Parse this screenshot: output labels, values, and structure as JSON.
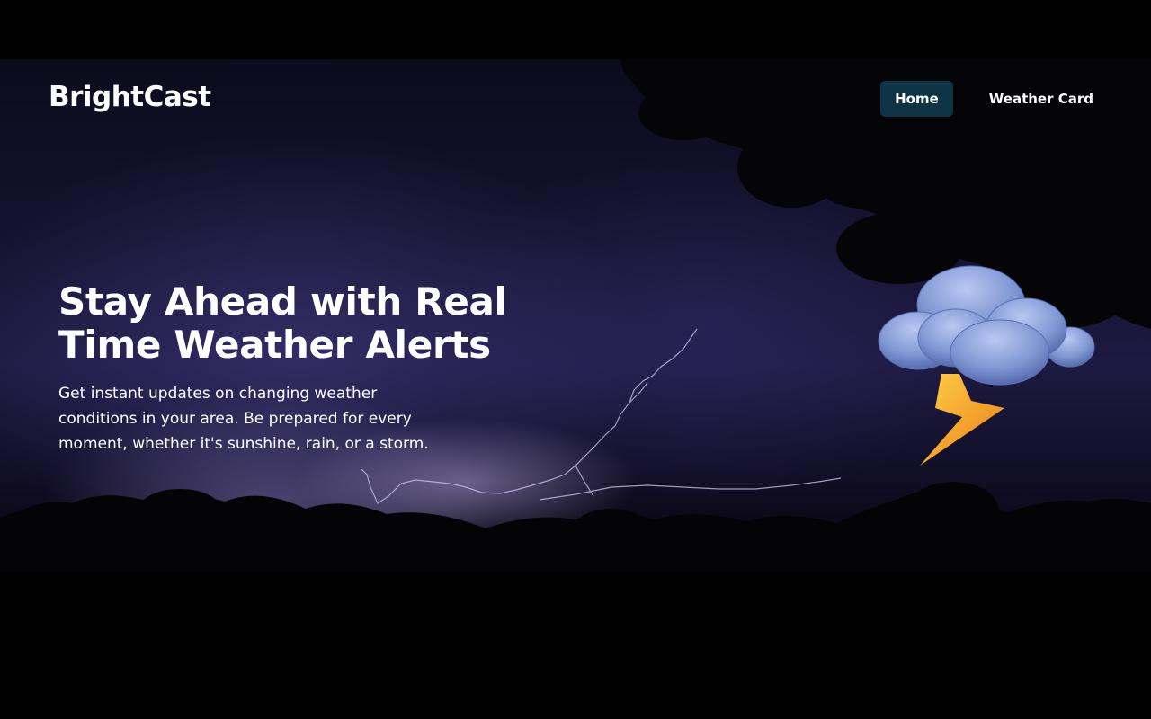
{
  "brand": {
    "name": "BrightCast"
  },
  "nav": {
    "items": [
      {
        "label": "Home",
        "active": true
      },
      {
        "label": "Weather Card",
        "active": false
      }
    ]
  },
  "hero": {
    "title": "Stay Ahead with Real Time Weather Alerts",
    "description": "Get instant updates on changing weather conditions in your area. Be prepared for every moment, whether it's sunshine, rain, or a storm.",
    "background_image": "stormy night sky with lightning and tree silhouettes",
    "icon": "thunderstorm-cloud-icon"
  },
  "colors": {
    "page_background": "#000000",
    "active_nav_background": "#0e3345",
    "text": "#ffffff",
    "cloud": "#7f96d2",
    "lightning": "#f39a1f"
  }
}
